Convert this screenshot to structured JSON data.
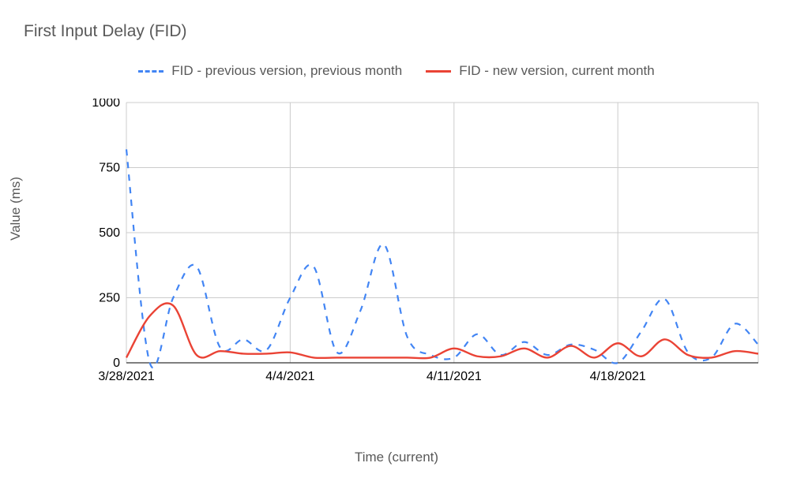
{
  "chart_data": {
    "type": "line",
    "title": "First Input Delay (FID)",
    "xlabel": "Time (current)",
    "ylabel": "Value (ms)",
    "ylim": [
      0,
      1000
    ],
    "ytick_labels": [
      "0",
      "250",
      "500",
      "750",
      "1000"
    ],
    "xtick_labels": [
      "3/28/2021",
      "4/4/2021",
      "4/11/2021",
      "4/18/2021"
    ],
    "xtick_positions": [
      0,
      7,
      14,
      21
    ],
    "x": [
      0,
      1,
      2,
      3,
      4,
      5,
      6,
      7,
      8,
      9,
      10,
      11,
      12,
      13,
      14,
      15,
      16,
      17,
      18,
      19,
      20,
      21,
      22,
      23,
      24,
      25,
      26,
      27
    ],
    "series": [
      {
        "name": "FID - previous version, previous month",
        "style": "dashed",
        "color": "#4285f4",
        "values": [
          820,
          0,
          250,
          370,
          60,
          90,
          50,
          250,
          370,
          40,
          200,
          455,
          100,
          30,
          20,
          110,
          30,
          80,
          30,
          70,
          50,
          0,
          120,
          245,
          40,
          20,
          150,
          70
        ]
      },
      {
        "name": "FID - new version, current month",
        "style": "solid",
        "color": "#ea4335",
        "values": [
          20,
          180,
          220,
          30,
          45,
          35,
          35,
          40,
          20,
          20,
          20,
          20,
          20,
          20,
          55,
          25,
          25,
          55,
          20,
          65,
          20,
          75,
          25,
          90,
          30,
          20,
          45,
          35
        ]
      }
    ]
  }
}
